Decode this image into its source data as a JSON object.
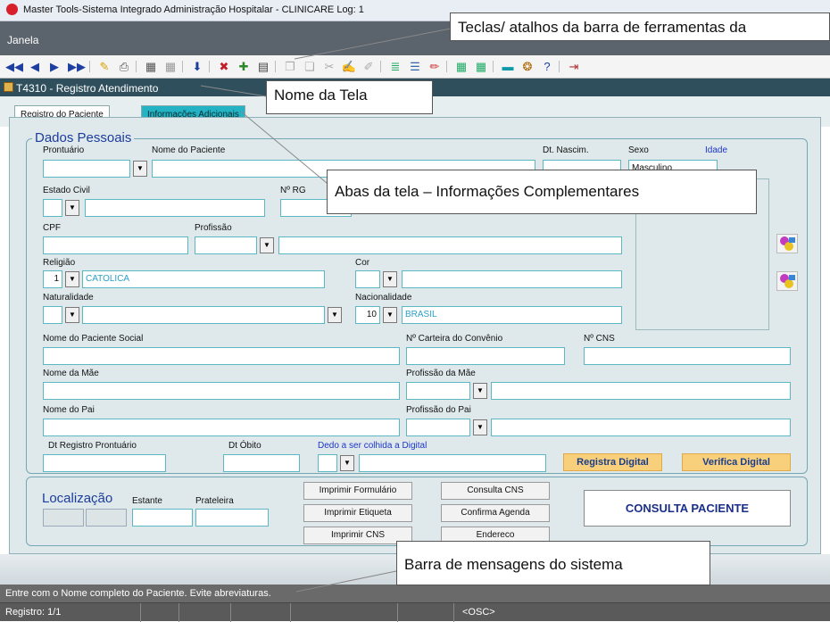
{
  "window": {
    "title": "Master Tools-Sistema Integrado Administração Hospitalar - CLINICARE Log: 1"
  },
  "menu": {
    "janela": "Janela"
  },
  "toolbar": {
    "icons": [
      "first-record-icon",
      "prev-record-icon",
      "next-record-icon",
      "last-record-icon",
      "clear-icon",
      "print-icon",
      "calculator-icon",
      "calc2-icon",
      "down-arrow-icon",
      "delete-record-icon",
      "insert-record-icon",
      "grid-icon",
      "copy-icon",
      "paste-icon",
      "cut-icon",
      "edit-icon",
      "tool-icon",
      "list-icon",
      "list2-icon",
      "pen-icon",
      "table-icon",
      "table2-icon",
      "flag-icon",
      "help2-icon",
      "help-icon",
      "exit-icon"
    ]
  },
  "form": {
    "title": "T4310 - Registro Atendimento"
  },
  "tabs": [
    "Registro do Paciente",
    "Informações Adicionais"
  ],
  "dados": {
    "legend": "Dados Pessoais",
    "prontuario": "Prontuário",
    "nome_paciente": "Nome do Paciente",
    "dt_nascim": "Dt. Nascim.",
    "sexo": "Sexo",
    "sexo_val": "Masculino",
    "idade": "Idade",
    "estado_civil": "Estado Civil",
    "rg": "Nº RG",
    "cpf": "CPF",
    "profissao": "Profissão",
    "religiao": "Religião",
    "religiao_cod": "1",
    "religiao_val": "CATOLICA",
    "cor": "Cor",
    "naturalidade": "Naturalidade",
    "nacionalidade": "Nacionalidade",
    "nacionalidade_cod": "10",
    "nacionalidade_val": "BRASIL",
    "nome_social": "Nome do Paciente Social",
    "carteira": "Nº  Carteira do  Convênio",
    "cns": "Nº  CNS",
    "nome_mae": "Nome da Mãe",
    "profissao_mae": "Profissão da Mãe",
    "nome_pai": "Nome do Pai",
    "profissao_pai": "Profissão do Pai",
    "dt_registro": "Dt Registro Prontuário",
    "dt_obito": "Dt Óbito",
    "dedo": "Dedo a ser colhida a Digital",
    "registra_digital": "Registra Digital",
    "verifica_digital": "Verifica Digital"
  },
  "localizacao": {
    "legend": "Localização",
    "estante": "Estante",
    "prateleira": "Prateleira",
    "imprimir_formulario": "Imprimir Formulário",
    "imprimir_etiqueta": "Imprimir Etiqueta",
    "imprimir_cns": "Imprimir CNS",
    "consulta_cns": "Consulta CNS",
    "confirma_agenda": "Confirma Agenda",
    "endereco": "Endereco",
    "consulta_paciente": "CONSULTA PACIENTE"
  },
  "callouts": {
    "toolbar": "Teclas/ atalhos da barra de ferramentas da",
    "screen_name": "Nome da Tela",
    "tabs": "Abas da tela – Informações Complementares",
    "msgbar": "Barra de mensagens do sistema"
  },
  "message": "Entre com o Nome completo do Paciente. Evite abreviaturas.",
  "status": {
    "registro": "Registro: 1/1",
    "osc": "<OSC>"
  },
  "colors": {
    "accent_tab": "#23b3c4",
    "gold_button": "#f8cf7a",
    "form_bar": "#2f4f5c",
    "legend_blue": "#1c3c9c"
  }
}
